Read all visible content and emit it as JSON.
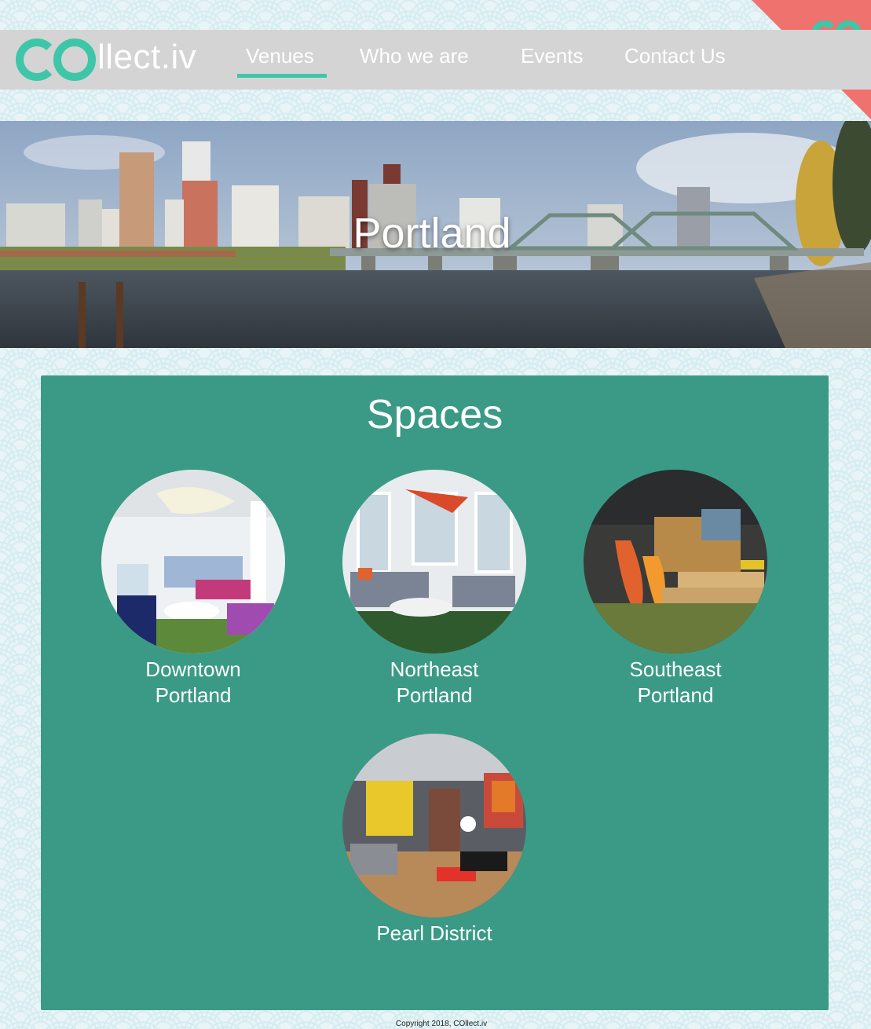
{
  "brand": {
    "logo_text": "llect.iv",
    "accent_color": "#3ec6a9",
    "corner_color": "#f0726f"
  },
  "nav": {
    "items": [
      {
        "label": "Venues",
        "active": true
      },
      {
        "label": "Who we are",
        "active": false
      },
      {
        "label": "Events",
        "active": false
      },
      {
        "label": "Contact Us",
        "active": false
      }
    ]
  },
  "hero": {
    "title": "Portland"
  },
  "spaces": {
    "title": "Spaces",
    "items": [
      {
        "label_line1": "Downtown",
        "label_line2": "Portland"
      },
      {
        "label_line1": "Northeast",
        "label_line2": "Portland"
      },
      {
        "label_line1": "Southeast",
        "label_line2": "Portland"
      },
      {
        "label_line1": "Pearl District",
        "label_line2": ""
      }
    ]
  },
  "footer": {
    "copyright": "Copyright 2018, COllect.iv"
  }
}
